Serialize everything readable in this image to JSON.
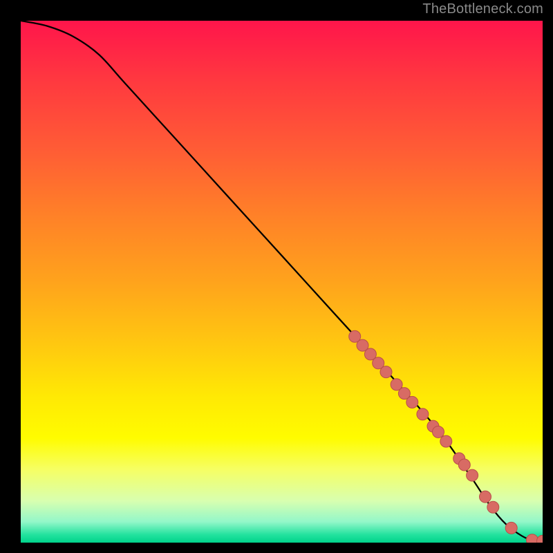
{
  "attribution": "TheBottleneck.com",
  "colors": {
    "page_bg": "#000000",
    "gradient_top": "#ff154b",
    "gradient_bottom": "#00d38b",
    "curve": "#000000",
    "marker_fill": "#d86b64",
    "marker_stroke": "#b94f49",
    "attribution_text": "#8a8a8a"
  },
  "chart_data": {
    "type": "line",
    "title": "",
    "xlabel": "",
    "ylabel": "",
    "xlim": [
      0,
      100
    ],
    "ylim": [
      0,
      100
    ],
    "grid": false,
    "series": [
      {
        "name": "curve",
        "x": [
          0,
          5,
          10,
          15,
          20,
          30,
          40,
          50,
          60,
          70,
          80,
          86,
          90,
          93,
          96,
          98,
          100
        ],
        "y": [
          100,
          99,
          97,
          93.5,
          88,
          77,
          66,
          55,
          44,
          33,
          21.5,
          13,
          7,
          3.5,
          1.3,
          0.5,
          0.3
        ]
      }
    ],
    "markers": {
      "name": "highlight-points",
      "x": [
        64,
        65.5,
        67,
        68.5,
        70,
        72,
        73.5,
        75,
        77,
        79,
        80,
        81.5,
        84,
        85,
        86.5,
        89,
        90.5,
        94,
        98,
        100
      ],
      "y": [
        39.5,
        37.8,
        36.1,
        34.4,
        32.7,
        30.3,
        28.6,
        26.9,
        24.6,
        22.3,
        21.2,
        19.4,
        16.1,
        14.9,
        12.9,
        8.8,
        6.8,
        2.8,
        0.5,
        0.3
      ]
    }
  }
}
